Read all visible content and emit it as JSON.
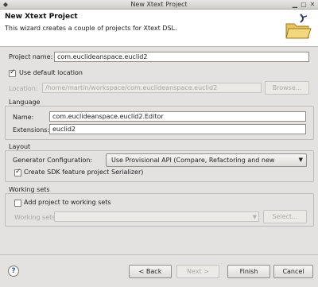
{
  "window": {
    "title": "New Xtext Project"
  },
  "header": {
    "title": "New Xtext Project",
    "description": "This wizard creates a couple of projects for Xtext DSL."
  },
  "project": {
    "name_label": "Project name:",
    "name_value": "com.euclideanspace.euclid2",
    "use_default_label": "Use default location",
    "use_default_checked": true,
    "location_label": "Location:",
    "location_value": "/home/martin/workspace/com.euclideanspace.euclid2",
    "browse_label": "Browse..."
  },
  "language": {
    "group_label": "Language",
    "name_label": "Name:",
    "name_value": "com.euclideanspace.euclid2.Editor",
    "extensions_label": "Extensions:",
    "extensions_value": "euclid2"
  },
  "layout": {
    "group_label": "Layout",
    "generator_label": "Generator Configuration:",
    "generator_value": "Use Provisional API (Compare, Refactoring and new Serializer)",
    "sdk_label": "Create SDK feature project",
    "sdk_checked": true
  },
  "working_sets": {
    "group_label": "Working sets",
    "add_label": "Add project to working sets",
    "add_checked": false,
    "sets_label": "Working sets:",
    "select_label": "Select..."
  },
  "footer": {
    "help_icon": "help-icon",
    "back_label": "< Back",
    "next_label": "Next >",
    "finish_label": "Finish",
    "cancel_label": "Cancel"
  }
}
